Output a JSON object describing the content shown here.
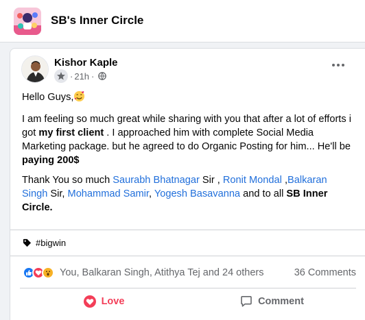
{
  "group": {
    "title": "SB's Inner Circle",
    "avatar_icon": "group-avatar-illustration"
  },
  "post": {
    "author": "Kishor Kaple",
    "time": "21h",
    "separator": "·",
    "audience_icon": "globe-icon",
    "badge_icon": "group-member-badge-icon",
    "more_icon": "more-options-icon",
    "greeting": "Hello Guys,",
    "p1_a": "I am feeling so much great while sharing with you that after a lot of efforts i got ",
    "p1_bold1": "my first client",
    "p1_b": " . I approached him with complete Social Media Marketing package. but he agreed to do Organic Posting for him... He'll be ",
    "p1_bold2": "paying 200$",
    "p2_a": "Thank You so much ",
    "mention_1": "Saurabh Bhatnagar",
    "p2_b": " Sir , ",
    "mention_2": "Ronit Mondal",
    "p2_c": " ,",
    "mention_3": "Balkaran Singh",
    "p2_d": " Sir, ",
    "mention_4": "Mohammad Samir",
    "p2_e": ", ",
    "mention_5": "Yogesh Basavanna",
    "p2_f": " and to all ",
    "p2_bold": "SB Inner Circle.",
    "hashtag": "#bigwin",
    "hashtag_icon": "tag-icon"
  },
  "reactions": {
    "icons": [
      "like-reaction-icon",
      "love-reaction-icon",
      "wow-reaction-icon"
    ],
    "summary": "You, Balkaran Singh, Atithya Tej and 24 others",
    "comments": "36 Comments"
  },
  "actions": {
    "love_label": "Love",
    "comment_label": "Comment"
  },
  "colors": {
    "link": "#216fdb",
    "love": "#f33e58",
    "like": "#1877f2",
    "muted": "#65676b",
    "background": "#f0f2f5"
  }
}
